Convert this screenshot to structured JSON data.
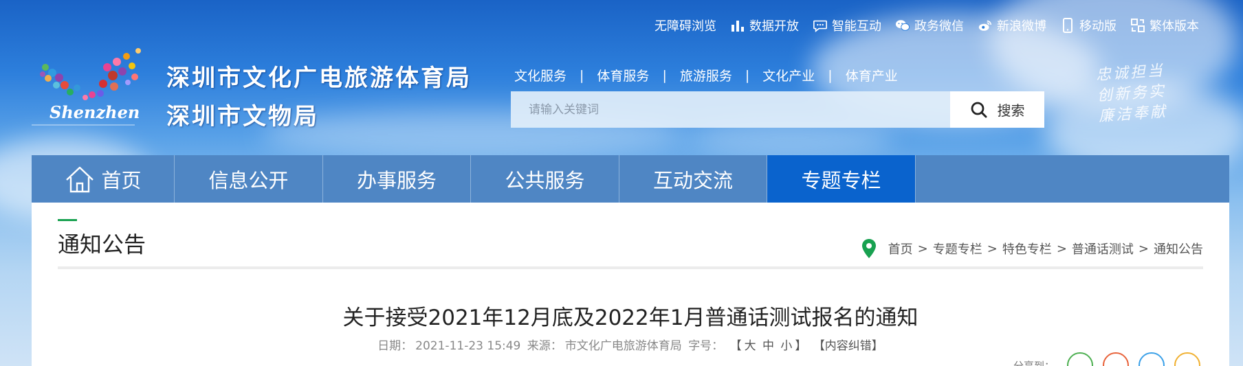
{
  "utility_links": [
    {
      "label": "无障碍浏览",
      "icon": "accessibility-icon"
    },
    {
      "label": "数据开放",
      "icon": "bar-chart-icon"
    },
    {
      "label": "智能互动",
      "icon": "chat-bubble-icon"
    },
    {
      "label": "政务微信",
      "icon": "wechat-icon"
    },
    {
      "label": "新浪微博",
      "icon": "weibo-icon"
    },
    {
      "label": "移动版",
      "icon": "mobile-phone-icon"
    },
    {
      "label": "繁体版本",
      "icon": "traditional-chinese-icon"
    }
  ],
  "header": {
    "org_name_line1": "深圳市文化广电旅游体育局",
    "org_name_line2": "深圳市文物局",
    "logo_text": "Shenzhen",
    "slogan": [
      "忠诚担当",
      "创新务实",
      "廉洁奉献"
    ]
  },
  "quick_links": [
    "文化服务",
    "体育服务",
    "旅游服务",
    "文化产业",
    "体育产业"
  ],
  "quick_link_separator": "|",
  "search": {
    "placeholder": "请输入关键词",
    "button_label": "搜索"
  },
  "main_nav": [
    {
      "label": "首页",
      "icon": "home-icon",
      "active": false
    },
    {
      "label": "信息公开",
      "active": false
    },
    {
      "label": "办事服务",
      "active": false
    },
    {
      "label": "公共服务",
      "active": false
    },
    {
      "label": "互动交流",
      "active": false
    },
    {
      "label": "专题专栏",
      "active": true
    }
  ],
  "section_title": "通知公告",
  "breadcrumb": {
    "items": [
      "首页",
      "专题专栏",
      "特色专栏",
      "普通话测试",
      "通知公告"
    ],
    "separator": ">"
  },
  "article": {
    "title": "关于接受2021年12月底及2022年1月普通话测试报名的通知",
    "date_label": "日期：",
    "date": "2021-11-23 15:49",
    "source_label": "来源：",
    "source": "市文化广电旅游体育局",
    "font_size_label": "字号：",
    "font_size_open": "【",
    "font_large": "大",
    "font_medium": "中",
    "font_small": "小",
    "font_size_close": "】",
    "error_report": "【内容纠错】"
  },
  "share": {
    "label": "分享到："
  },
  "colors": {
    "nav_bg": "#4f86c4",
    "nav_active": "#0a63cd",
    "accent_green": "#18a150",
    "breadcrumb_pin": "#18a150"
  }
}
